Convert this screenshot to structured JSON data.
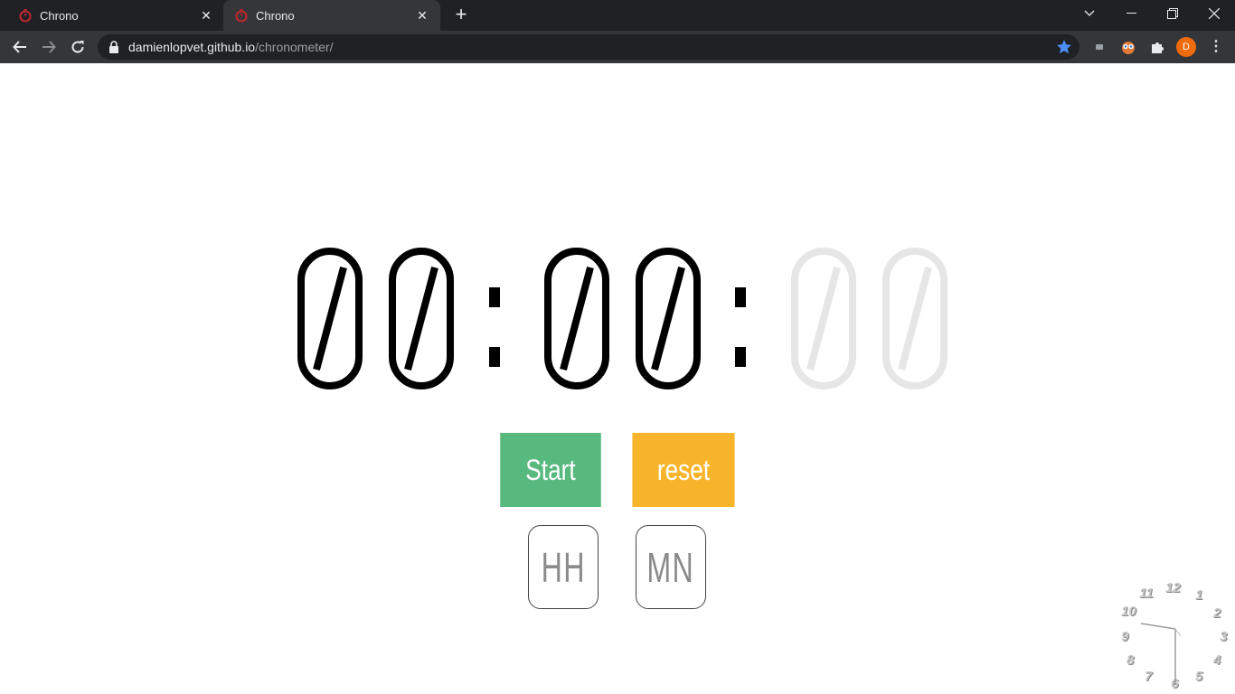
{
  "browser": {
    "tabs": [
      {
        "title": "Chrono",
        "active": false
      },
      {
        "title": "Chrono",
        "active": true
      }
    ],
    "url_host": "damienlopvet.github.io",
    "url_path": "/chronometer/",
    "avatar_letter": "D",
    "accent_color": "#8ab4f8",
    "avatar_color": "#f06b0c"
  },
  "chrono": {
    "hours": "00",
    "minutes": "00",
    "seconds": "00",
    "separator": ":",
    "active_color": "#000000",
    "inactive_color": "#e6e6e6"
  },
  "controls": {
    "start_label": "Start",
    "reset_label": "reset",
    "start_color": "#58b97e",
    "reset_color": "#f8b52c"
  },
  "inputs": {
    "hours_placeholder": "HH",
    "minutes_placeholder": "MN"
  },
  "clock": {
    "numbers": [
      "12",
      "1",
      "2",
      "3",
      "4",
      "5",
      "6",
      "7",
      "8",
      "9",
      "10",
      "11"
    ]
  }
}
